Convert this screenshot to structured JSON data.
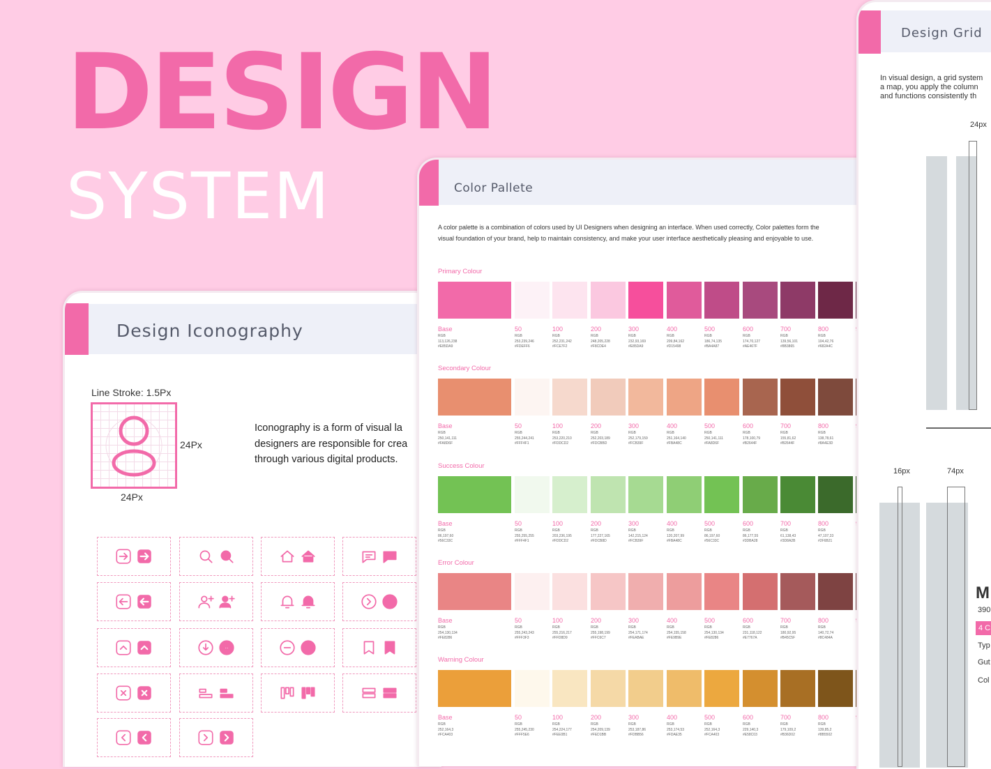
{
  "hero": {
    "title": "DESIGN",
    "subtitle": "SYSTEM"
  },
  "colors": {
    "accent": "#f26aa9",
    "background": "#ffcce5",
    "header": "#eef0f8"
  },
  "iconography": {
    "title": "Design Iconography",
    "stroke_label": "Line Stroke: 1.5Px",
    "dim_width": "24Px",
    "dim_height": "24Px",
    "description": "Iconography is a form of visual la designers are responsible for crea through various digital products.",
    "icons": [
      "arrow-right-icon",
      "search-icon",
      "home-icon",
      "chat-icon",
      "arrow-left-icon",
      "add-user-icon",
      "bell-icon",
      "chevron-right-icon",
      "chevron-up-icon",
      "download-icon",
      "minus-icon",
      "bookmark-icon",
      "close-icon",
      "bar-align-icon",
      "kanban-icon",
      "list-icon",
      "chevron-left-icon",
      "chevron-right-square-icon"
    ]
  },
  "palette": {
    "title": "Color Pallete",
    "description": "A color palette is a combination of colors used by UI Designers when designing an interface. When used correctly, Color palettes form the visual foundation of your brand, help to maintain consistency, and make your user interface aesthetically pleasing and enjoyable to use.",
    "shades": [
      "Base",
      "50",
      "100",
      "200",
      "300",
      "400",
      "500",
      "600",
      "700",
      "800",
      "9"
    ],
    "sections": [
      {
        "label": "Primary Colour",
        "colors": [
          "#f26aa9",
          "#fdf2f7",
          "#fde4ef",
          "#fbc8e0",
          "#f64f9c",
          "#e05b9b",
          "#bf4c88",
          "#a84a7e",
          "#8e3a67",
          "#6e2847",
          "#5a1e3a"
        ],
        "rgb": [
          "RGB\n113,126,238\n#E85DA9",
          "RGB\n253,239,246\n#FDEFF6",
          "RGB\n252,231,242\n#FCE7F2",
          "RGB\n248,205,228\n#F8CDE4",
          "RGB\n232,93,169\n#E85DA9",
          "RGB\n209,84,162\n#D15498",
          "RGB\n186,74,135\n#BA4A87",
          "RGB\n174,70,127\n#AE467F",
          "RGB\n139,56,101\n#8B3865",
          "RGB\n104,42,76\n#682A4C"
        ]
      },
      {
        "label": "Secondary Colour",
        "colors": [
          "#e88f6f",
          "#fdf5f2",
          "#f6d9cd",
          "#f1cbbb",
          "#f2b89c",
          "#eea585",
          "#e88f6f",
          "#a8654f",
          "#8f4f3a",
          "#7e4a3c",
          "#6b3a2c"
        ],
        "rgb": [
          "RGB\n250,141,111\n#FA8D6F",
          "RGB\n255,244,241\n#FFF4F1",
          "RGB\n253,220,210\n#FDDCD2",
          "RGB\n252,203,189\n#FDCBBD",
          "RGB\n252,179,159\n#FCB39F",
          "RGB\n251,164,140\n#FBA48C",
          "RGB\n250,141,111\n#FA8D6F",
          "RGB\n178,100,79\n#B2644F",
          "RGB\n155,81,62\n#B2644F",
          "RGB\n138,78,61\n#8A4E3D"
        ]
      },
      {
        "label": "Success Colour",
        "colors": [
          "#73c254",
          "#f1f9ee",
          "#d6efcd",
          "#bfe4b0",
          "#a6da92",
          "#8fce75",
          "#73c254",
          "#68ab4a",
          "#4a8a35",
          "#3b6a2b",
          "#2f5a22"
        ],
        "rgb": [
          "RGB\n86,197,60\n#56C33C",
          "RGB\n255,255,255\n#FFF4F1",
          "RGB\n203,236,195\n#FDDCD2",
          "RGB\n177,227,165\n#FDCB8D",
          "RGB\n142,215,124\n#FCB39F",
          "RGB\n120,207,99\n#FBA48C",
          "RGB\n86,197,60\n#56C33C",
          "RGB\n86,177,55\n#3DBA28",
          "RGB\n61,138,43\n#3D8A2B",
          "RGB\n47,107,33\n#2F6B21"
        ]
      },
      {
        "label": "Error Colour",
        "colors": [
          "#e98585",
          "#fdf0f0",
          "#fbe0e0",
          "#f6c6c6",
          "#f0aeae",
          "#ed9d9d",
          "#e98585",
          "#d46f70",
          "#a55a5b",
          "#7e4342",
          "#6a3535"
        ],
        "rgb": [
          "RGB\n254,130,134\n#FE8286",
          "RGB\n255,243,243\n#FFF3F3",
          "RGB\n255,216,217\n#FFD8D9",
          "RGB\n255,198,199\n#FFC6C7",
          "RGB\n254,171,174\n#FEABAE",
          "RGB\n254,155,158\n#FE9B9E",
          "RGB\n254,130,134\n#FE8286",
          "RGB\n231,118,122\n#E7767A",
          "RGB\n180,92,95\n#B45C5F",
          "RGB\n140,72,74\n#8C484A"
        ]
      },
      {
        "label": "Warning Colour",
        "colors": [
          "#eb9f3a",
          "#fef8ec",
          "#f9e6c1",
          "#f5d9a7",
          "#f2cd8c",
          "#efbc6a",
          "#eca83f",
          "#d48f2f",
          "#a86f24",
          "#7e551b",
          "#6a4515"
        ],
        "rgb": [
          "RGB\n252,164,3\n#FCA403",
          "RGB\n255,245,230\n#FFF5E6",
          "RGB\n254,224,177\n#FEE0B1",
          "RGB\n254,209,139\n#FED1BB",
          "RGB\n253,187,86\n#FDBB56",
          "RGB\n253,174,53\n#FDAE35",
          "RGB\n252,164,3\n#FCA403",
          "RGB\n229,140,3\n#E58C03",
          "RGB\n179,109,2\n#B36D02",
          "RGB\n139,85,2\n#8B5502"
        ]
      }
    ]
  },
  "grid": {
    "title": "Design Grid",
    "description": [
      "In visual design, a grid system",
      "a map, you apply the column",
      "and functions consistently th"
    ],
    "label_top": "24px",
    "label_gutter": "16px",
    "label_column": "74px",
    "side_heading": "M",
    "side_value": "390",
    "side_badge": "4 C",
    "side_rows": [
      "Typ",
      "Gut",
      "Col"
    ]
  }
}
